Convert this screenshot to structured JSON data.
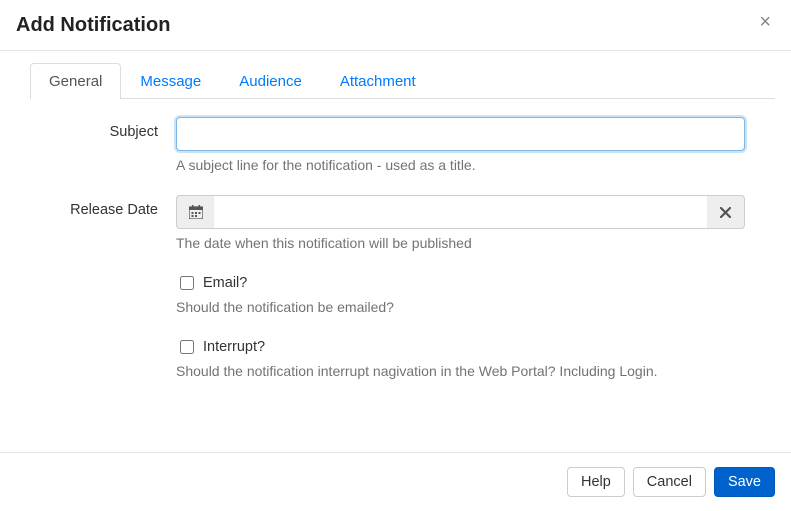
{
  "header": {
    "title": "Add Notification"
  },
  "tabs": {
    "general": "General",
    "message": "Message",
    "audience": "Audience",
    "attachment": "Attachment"
  },
  "form": {
    "subject": {
      "label": "Subject",
      "value": "",
      "help": "A subject line for the notification - used as a title."
    },
    "release_date": {
      "label": "Release Date",
      "value": "",
      "help": "The date when this notification will be published"
    },
    "email": {
      "label": "Email?",
      "checked": false,
      "help": "Should the notification be emailed?"
    },
    "interrupt": {
      "label": "Interrupt?",
      "checked": false,
      "help": "Should the notification interrupt nagivation in the Web Portal? Including Login."
    }
  },
  "footer": {
    "help": "Help",
    "cancel": "Cancel",
    "save": "Save"
  }
}
